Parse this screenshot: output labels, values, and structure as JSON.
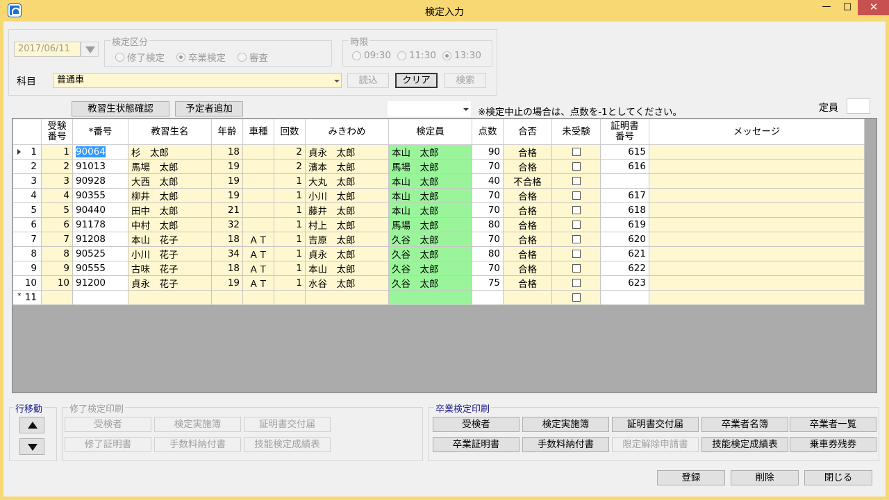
{
  "window": {
    "title": "検定入力"
  },
  "filters": {
    "date": "2017/06/11",
    "kubun_label": "検定区分",
    "kubun_options": [
      "修了検定",
      "卒業検定",
      "審査"
    ],
    "kubun_selected": "卒業検定",
    "jigen_label": "時限",
    "jigen_options": [
      "09:30",
      "11:30",
      "13:30"
    ],
    "jigen_selected": "13:30",
    "subject_label": "科目",
    "subject_value": "普通車",
    "load_btn": "読込",
    "clear_btn": "クリア",
    "search_btn": "検索"
  },
  "toolbar": {
    "status_btn": "教習生状態確認",
    "add_btn": "予定者追加",
    "note": "※検定中止の場合は、点数を-1としてください。",
    "teiin_label": "定員",
    "teiin_value": ""
  },
  "grid": {
    "headers": [
      "受験\n番号",
      "*番号",
      "教習生名",
      "年齢",
      "車種",
      "回数",
      "みきわめ",
      "検定員",
      "点数",
      "合否",
      "未受験",
      "証明書\n番号",
      "メッセージ"
    ],
    "rows": [
      {
        "row": "1",
        "no": "1",
        "id": "90064",
        "name": "杉　太郎",
        "age": "18",
        "car": "",
        "count": "2",
        "mikiwame": "貞永　太郎",
        "kenteiin": "本山　太郎",
        "score": "90",
        "result": "合格",
        "cert": "615"
      },
      {
        "row": "2",
        "no": "2",
        "id": "91013",
        "name": "馬場　太郎",
        "age": "19",
        "car": "",
        "count": "2",
        "mikiwame": "濱本　太郎",
        "kenteiin": "馬場　太郎",
        "score": "70",
        "result": "合格",
        "cert": "616"
      },
      {
        "row": "3",
        "no": "3",
        "id": "90928",
        "name": "大西　太郎",
        "age": "19",
        "car": "",
        "count": "1",
        "mikiwame": "大丸　太郎",
        "kenteiin": "本山　太郎",
        "score": "40",
        "result": "不合格",
        "cert": ""
      },
      {
        "row": "4",
        "no": "4",
        "id": "90355",
        "name": "柳井　太郎",
        "age": "19",
        "car": "",
        "count": "1",
        "mikiwame": "小川　太郎",
        "kenteiin": "本山　太郎",
        "score": "70",
        "result": "合格",
        "cert": "617"
      },
      {
        "row": "5",
        "no": "5",
        "id": "90440",
        "name": "田中　太郎",
        "age": "21",
        "car": "",
        "count": "1",
        "mikiwame": "藤井　太郎",
        "kenteiin": "本山　太郎",
        "score": "70",
        "result": "合格",
        "cert": "618"
      },
      {
        "row": "6",
        "no": "6",
        "id": "91178",
        "name": "中村　太郎",
        "age": "32",
        "car": "",
        "count": "1",
        "mikiwame": "村上　太郎",
        "kenteiin": "馬場　太郎",
        "score": "80",
        "result": "合格",
        "cert": "619"
      },
      {
        "row": "7",
        "no": "7",
        "id": "91208",
        "name": "本山　花子",
        "age": "18",
        "car": "ＡＴ",
        "count": "1",
        "mikiwame": "吉原　太郎",
        "kenteiin": "久谷　太郎",
        "score": "70",
        "result": "合格",
        "cert": "620"
      },
      {
        "row": "8",
        "no": "8",
        "id": "90525",
        "name": "小川　花子",
        "age": "34",
        "car": "ＡＴ",
        "count": "1",
        "mikiwame": "貞永　太郎",
        "kenteiin": "久谷　太郎",
        "score": "80",
        "result": "合格",
        "cert": "621"
      },
      {
        "row": "9",
        "no": "9",
        "id": "90555",
        "name": "古味　花子",
        "age": "18",
        "car": "ＡＴ",
        "count": "1",
        "mikiwame": "本山　太郎",
        "kenteiin": "久谷　太郎",
        "score": "70",
        "result": "合格",
        "cert": "622"
      },
      {
        "row": "10",
        "no": "10",
        "id": "91200",
        "name": "貞永　花子",
        "age": "19",
        "car": "ＡＴ",
        "count": "1",
        "mikiwame": "水谷　太郎",
        "kenteiin": "久谷　太郎",
        "score": "75",
        "result": "合格",
        "cert": "623"
      }
    ],
    "new_row_label": "11"
  },
  "move": {
    "label": "行移動"
  },
  "shuryo": {
    "label": "修了検定印刷",
    "buttons": [
      "受検者",
      "検定実施簿",
      "証明書交付届",
      "修了証明書",
      "手数料納付書",
      "技能検定成績表"
    ]
  },
  "sotsugyo": {
    "label": "卒業検定印刷",
    "buttons": [
      "受検者",
      "検定実施簿",
      "証明書交付届",
      "卒業者名簿",
      "卒業者一覧",
      "卒業証明書",
      "手数料納付書",
      "限定解除申請書",
      "技能検定成績表",
      "乗車券残券"
    ]
  },
  "footer": {
    "register": "登録",
    "delete": "削除",
    "close": "閉じる"
  }
}
